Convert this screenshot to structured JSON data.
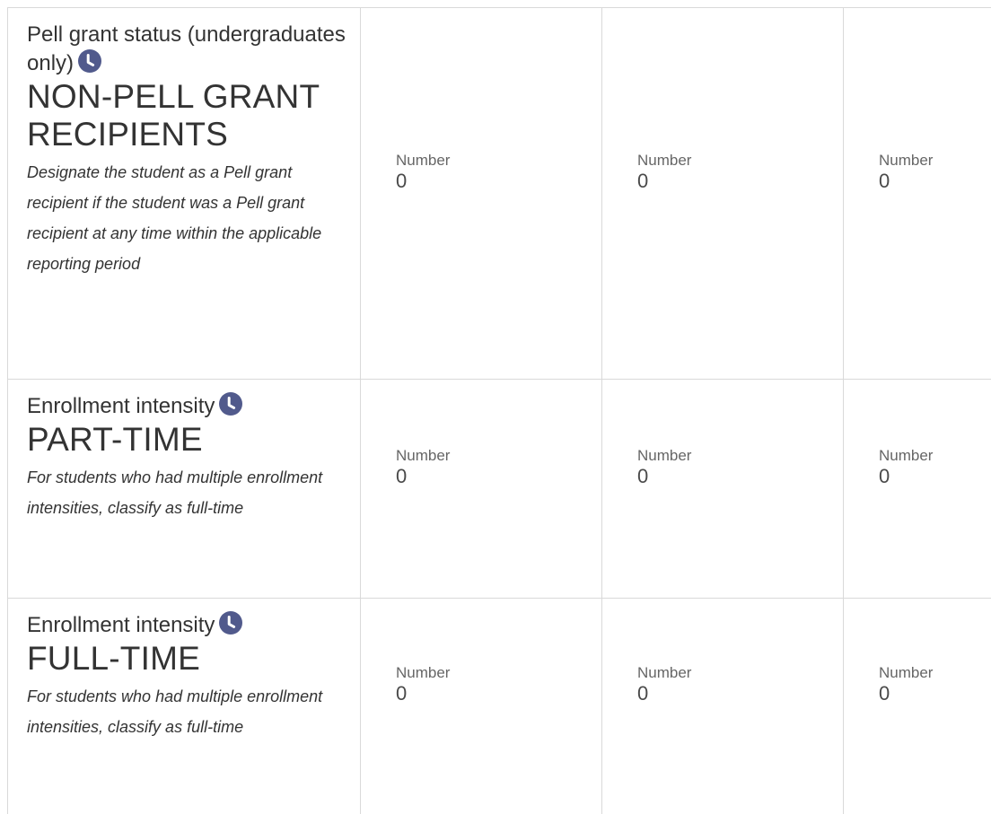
{
  "colors": {
    "icon_fill": "#515a8c",
    "border": "#d9d9d9",
    "text": "#333333"
  },
  "rows": [
    {
      "field_title": "Pell grant status (undergraduates only)",
      "icon": "clock-icon",
      "category": "NON-PELL GRANT RECIPIENTS",
      "hint": "Designate the student as a Pell grant recipient if the student was a Pell grant recipient at any time within the applicable reporting period",
      "cells": [
        {
          "label": "Number",
          "value": "0"
        },
        {
          "label": "Number",
          "value": "0"
        },
        {
          "label": "Number",
          "value": "0"
        }
      ]
    },
    {
      "field_title": "Enrollment intensity",
      "icon": "clock-icon",
      "category": "PART-TIME",
      "hint": "For students who had multiple enrollment intensities, classify as full-time",
      "cells": [
        {
          "label": "Number",
          "value": "0"
        },
        {
          "label": "Number",
          "value": "0"
        },
        {
          "label": "Number",
          "value": "0"
        }
      ]
    },
    {
      "field_title": "Enrollment intensity",
      "icon": "clock-icon",
      "category": "FULL-TIME",
      "hint": "For students who had multiple enrollment intensities, classify as full-time",
      "cells": [
        {
          "label": "Number",
          "value": "0"
        },
        {
          "label": "Number",
          "value": "0"
        },
        {
          "label": "Number",
          "value": "0"
        }
      ]
    }
  ]
}
